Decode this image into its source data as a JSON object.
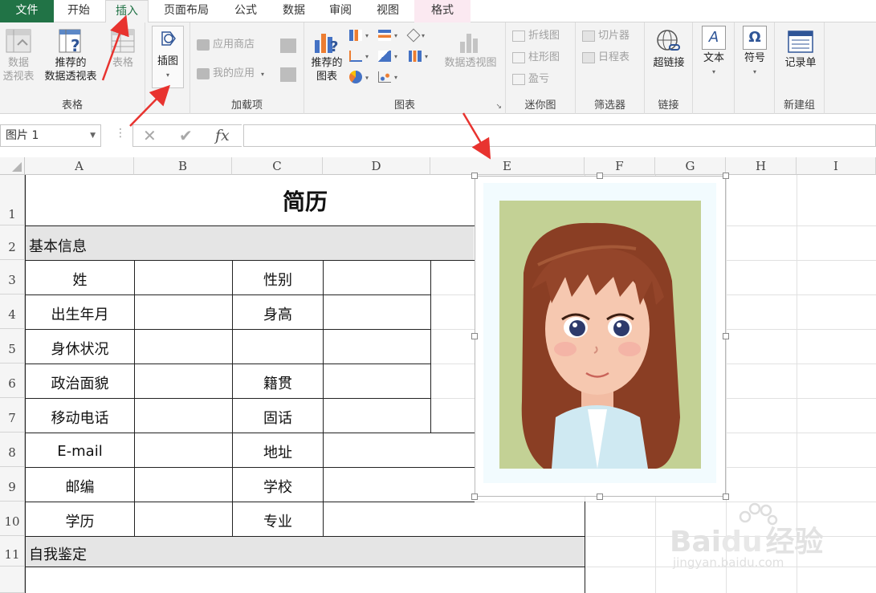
{
  "tabs": {
    "file": "文件",
    "home": "开始",
    "insert": "插入",
    "layout": "页面布局",
    "formulas": "公式",
    "data": "数据",
    "review": "审阅",
    "view": "视图",
    "format": "格式"
  },
  "ribbon": {
    "tables": {
      "pivot_line1": "数据",
      "pivot_line2": "透视表",
      "rec_pivot_line1": "推荐的",
      "rec_pivot_line2": "数据透视表",
      "table": "表格",
      "group": "表格"
    },
    "illustrations": {
      "label": "插图",
      "caret": "▾"
    },
    "addins": {
      "store": "应用商店",
      "my_apps": "我的应用",
      "group": "加载项"
    },
    "charts": {
      "rec_line1": "推荐的",
      "rec_line2": "图表",
      "pivot_chart": "数据透视图",
      "group": "图表",
      "launcher": "↘"
    },
    "sparklines": {
      "line": "折线图",
      "column": "柱形图",
      "winloss": "盈亏",
      "group": "迷你图"
    },
    "filters": {
      "slicer": "切片器",
      "timeline": "日程表",
      "group": "筛选器"
    },
    "links": {
      "hyperlink": "超链接",
      "group": "链接"
    },
    "text": {
      "label": "文本",
      "icon": "A",
      "caret": "▾"
    },
    "symbols": {
      "label": "符号",
      "icon": "Ω",
      "caret": "▾"
    },
    "newgroup": {
      "form": "记录单",
      "group": "新建组"
    }
  },
  "formula_bar": {
    "name_box": "图片 1",
    "cancel": "✕",
    "enter": "✔",
    "fx": "fx",
    "value": ""
  },
  "columns": [
    "A",
    "B",
    "C",
    "D",
    "E",
    "F",
    "G",
    "H",
    "I"
  ],
  "rows": [
    "1",
    "2",
    "3",
    "4",
    "5",
    "6",
    "7",
    "8",
    "9",
    "10",
    "11"
  ],
  "sheet": {
    "title": "简历",
    "section_basic": "基本信息",
    "section_self": "自我鉴定",
    "labels_a": [
      "姓",
      "出生年月",
      "身休状况",
      "政治面貌",
      "移动电话",
      "E-mail",
      "邮编",
      "学历"
    ],
    "labels_c": [
      "性别",
      "身高",
      "",
      "籍贯",
      "固话",
      "地址",
      "学校",
      "专业"
    ]
  },
  "watermark": {
    "brand_left": "Bai",
    "brand_right": "经验",
    "url": "jingyan.baidu.com"
  },
  "colors": {
    "excel_green": "#217346",
    "arrow_red": "#e8332f",
    "photo_bg": "#c3d195",
    "hair": "#8a3e24",
    "skin": "#f6c8b0",
    "shirt": "#cfe9f2"
  }
}
